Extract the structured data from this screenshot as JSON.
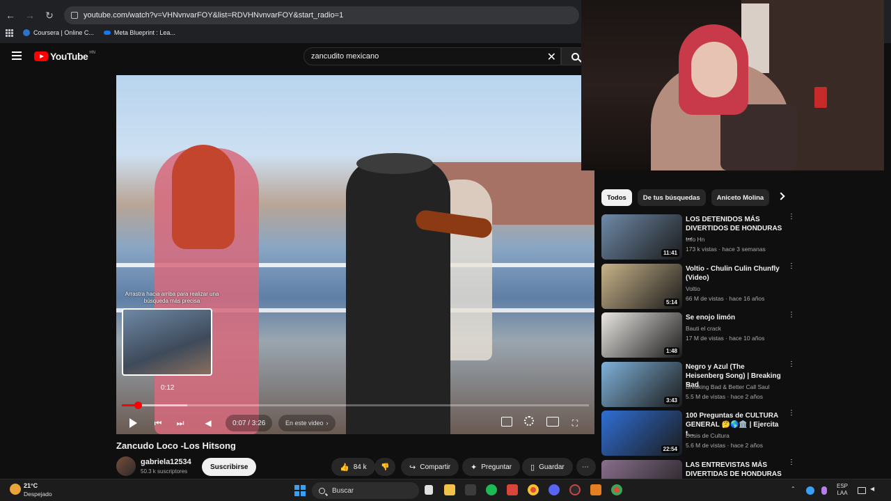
{
  "browser": {
    "url": "youtube.com/watch?v=VHNvnvarFOY&list=RDVHNvnvarFOY&start_radio=1",
    "bookmarks": [
      "Coursera | Online C...",
      "Meta Blueprint : Lea..."
    ]
  },
  "header": {
    "logo_text": "YouTube",
    "country_code": "HN",
    "search_query": "zancudito mexicano"
  },
  "player": {
    "hint": "Arrastra hacia arriba para realizar una búsqueda más precisa",
    "preview_time": "0:12",
    "time_display": "0:07 / 3:26",
    "chapter_label": "En este video",
    "progress_fraction": 0.035,
    "buffer_fraction": 0.14
  },
  "video": {
    "title": "Zancudo Loco -Los Hitsong",
    "channel": "gabriela12534",
    "subscribers": "50.3 k suscriptores",
    "subscribe_label": "Suscribirse",
    "like_count": "84 k",
    "share_label": "Compartir",
    "ask_label": "Preguntar",
    "save_label": "Guardar"
  },
  "sidebar": {
    "chips": [
      "Todos",
      "De tus búsquedas",
      "Aniceto Molina"
    ],
    "recommendations": [
      {
        "title": "LOS DETENIDOS MÁS DIVERTIDOS DE HONDURAS ...",
        "channel": "Info Hn",
        "meta": "173 k vistas · hace 3 semanas",
        "duration": "11:41",
        "thumb_color": "#6f8aa8"
      },
      {
        "title": "Voltio - Chulin Culin Chunfly (Video)",
        "channel": "Voltio",
        "meta": "66 M de vistas · hace 16 años",
        "duration": "5:14",
        "thumb_color": "#c9b48a"
      },
      {
        "title": "Se enojo limón",
        "channel": "Bauti el crack",
        "meta": "17 M de vistas · hace 10 años",
        "duration": "1:48",
        "thumb_color": "#e9e6e2"
      },
      {
        "title": "Negro y Azul (The Heisenberg Song) | Breaking Bad",
        "channel": "Breaking Bad & Better Call Saul",
        "meta": "5.5 M de vistas · hace 2 años",
        "duration": "3:43",
        "thumb_color": "#7fb2d9"
      },
      {
        "title": "100 Preguntas de CULTURA GENERAL 🤔🌎🏛️ | Ejercita t...",
        "channel": "Dosis de Cultura",
        "meta": "5.6 M de vistas · hace 2 años",
        "duration": "22:54",
        "thumb_color": "#2f6fd6"
      },
      {
        "title": "LAS ENTREVISTAS MÁS DIVERTIDAS DE HONDURAS ...",
        "channel": "",
        "meta": "",
        "duration": "",
        "thumb_color": "#8a6f8e"
      }
    ]
  },
  "taskbar": {
    "temperature": "21°C",
    "condition": "Despejado",
    "search_label": "Buscar",
    "lang_top": "ESP",
    "lang_bottom": "LAA"
  },
  "colors": {
    "yt_red": "#ff0000",
    "background": "#0f0f0f"
  }
}
